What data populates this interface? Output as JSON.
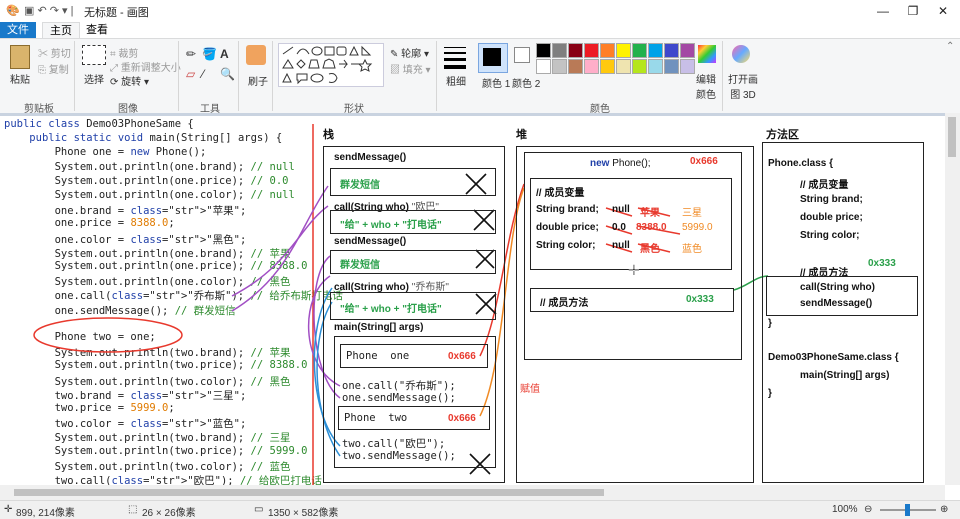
{
  "window": {
    "title": "无标题 - 画图",
    "minimize": "—",
    "restore": "❐",
    "close": "✕"
  },
  "tabs": {
    "file": "文件",
    "home": "主页",
    "view": "查看"
  },
  "ribbon": {
    "clipboard": {
      "label": "剪贴板",
      "paste": "粘贴",
      "cut": "剪切",
      "copy": "复制"
    },
    "image": {
      "label": "图像",
      "select": "选择",
      "crop": "裁剪",
      "resize": "重新调整大小",
      "rotate": "旋转"
    },
    "tools": {
      "label": "工具"
    },
    "brushes": {
      "label": "刷子"
    },
    "shapes": {
      "label": "形状",
      "outline": "轮廓",
      "fill": "填充"
    },
    "size": {
      "label": "粗细"
    },
    "color1": "颜色 1",
    "color2": "颜色 2",
    "colors": {
      "label": "颜色",
      "edit": "编辑颜色",
      "palette": [
        "#000000",
        "#7f7f7f",
        "#880015",
        "#ed1c24",
        "#ff7f27",
        "#fff200",
        "#22b14c",
        "#00a2e8",
        "#3f48cc",
        "#a349a4",
        "#ffffff",
        "#c3c3c3",
        "#b97a57",
        "#ffaec9",
        "#ffc90e",
        "#efe4b0",
        "#b5e61d",
        "#99d9ea",
        "#7092be",
        "#c8bfe7"
      ]
    },
    "paint3d": "打开画图 3D"
  },
  "code": {
    "lines": [
      "public class Demo03PhoneSame {",
      "    public static void main(String[] args) {",
      "        Phone one = new Phone();",
      "        System.out.println(one.brand); // null",
      "        System.out.println(one.price); // 0.0",
      "        System.out.println(one.color); // null",
      "        one.brand = \"苹果\";",
      "        one.price = 8388.0;",
      "        one.color = \"黑色\";",
      "        System.out.println(one.brand); // 苹果",
      "        System.out.println(one.price); // 8388.0",
      "        System.out.println(one.color); // 黑色",
      "        one.call(\"乔布斯\"); // 给乔布斯打电话",
      "        one.sendMessage(); // 群发短信",
      "",
      "        Phone two = one;",
      "        System.out.println(two.brand); // 苹果",
      "        System.out.println(two.price); // 8388.0",
      "        System.out.println(two.color); // 黑色",
      "        two.brand = \"三星\";",
      "        two.price = 5999.0;",
      "        two.color = \"蓝色\";",
      "        System.out.println(two.brand); // 三星",
      "        System.out.println(two.price); // 5999.0",
      "        System.out.println(two.color); // 蓝色",
      "        two.call(\"欧巴\"); // 给欧巴打电话"
    ]
  },
  "diagram": {
    "stack": "栈",
    "heap": "堆",
    "method_area": "方法区",
    "stack_frames": {
      "send1": "sendMessage()",
      "send1_body": "群发短信",
      "call1": "call(String who)",
      "call1_arg": "\"欧巴\"",
      "call1_body": "\"给\" + who + \"打电话\"",
      "send2": "sendMessage()",
      "send2_body": "群发短信",
      "call2": "call(String who)",
      "call2_arg": "\"乔布斯\"",
      "call2_body": "\"给\" + who + \"打电话\"",
      "main": "main(String[] args)",
      "phone_one": "Phone  one",
      "addr1": "0x666",
      "one_call": "one.call(\"乔布斯\");",
      "one_send": "one.sendMessage();",
      "phone_two": "Phone  two",
      "addr2": "0x666",
      "two_call": "two.call(\"欧巴\");",
      "two_send": "two.sendMessage();"
    },
    "heap_obj": {
      "new_phone_kw": "new",
      "new_phone": "Phone();",
      "addr": "0x666",
      "members": "// 成员变量",
      "brand": "String brand;",
      "brand_null": "null",
      "brand_v1": "苹果",
      "brand_v2": "三星",
      "price": "double price;",
      "price_zero": "0.0",
      "price_v1": "8388.0",
      "price_v2": "5999.0",
      "color": "String color;",
      "color_null": "null",
      "color_v1": "黑色",
      "color_v2": "蓝色",
      "methods": "// 成员方法",
      "methods_addr": "0x333",
      "assign": "赋值"
    },
    "method_area_content": {
      "phone_class": "Phone.class {",
      "members": "// 成员变量",
      "brand": "String brand;",
      "price": "double price;",
      "color": "String color;",
      "methods": "// 成员方法",
      "methods_addr": "0x333",
      "call": "call(String who)",
      "send": "sendMessage()",
      "close1": "}",
      "demo_class": "Demo03PhoneSame.class {",
      "main": "main(String[] args)",
      "close2": "}"
    }
  },
  "status": {
    "cursor": "899, 214像素",
    "selection": "26 × 26像素",
    "canvas_size": "1350 × 582像素",
    "zoom": "100%"
  }
}
